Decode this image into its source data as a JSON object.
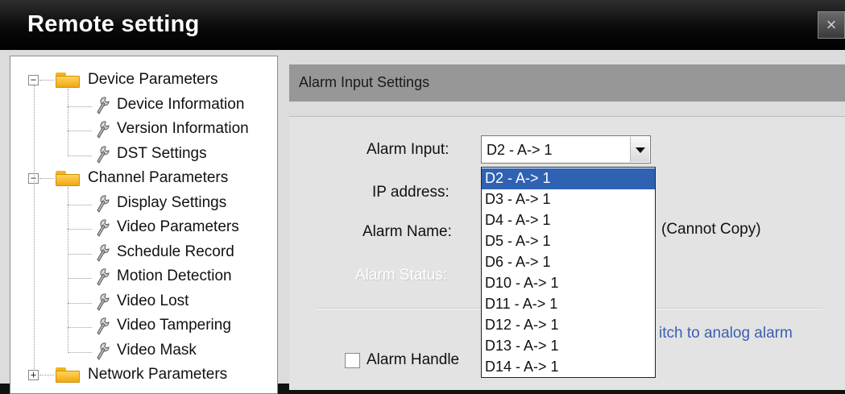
{
  "window": {
    "title": "Remote setting",
    "close_symbol": "×"
  },
  "tree": {
    "items": [
      {
        "label": "Device Parameters",
        "type": "folder",
        "expander": "−",
        "icon": "folder-icon"
      },
      {
        "label": "Device Information",
        "type": "leaf",
        "icon": "wrench-icon"
      },
      {
        "label": "Version Information",
        "type": "leaf",
        "icon": "wrench-icon"
      },
      {
        "label": "DST Settings",
        "type": "leaf",
        "icon": "wrench-icon"
      },
      {
        "label": "Channel Parameters",
        "type": "folder",
        "expander": "−",
        "icon": "folder-icon"
      },
      {
        "label": "Display Settings",
        "type": "leaf",
        "icon": "wrench-icon"
      },
      {
        "label": "Video Parameters",
        "type": "leaf",
        "icon": "wrench-icon"
      },
      {
        "label": "Schedule Record",
        "type": "leaf",
        "icon": "wrench-icon"
      },
      {
        "label": "Motion Detection",
        "type": "leaf",
        "icon": "wrench-icon"
      },
      {
        "label": "Video Lost",
        "type": "leaf",
        "icon": "wrench-icon"
      },
      {
        "label": "Video Tampering",
        "type": "leaf",
        "icon": "wrench-icon"
      },
      {
        "label": "Video Mask",
        "type": "leaf",
        "icon": "wrench-icon"
      },
      {
        "label": "Network Parameters",
        "type": "folder",
        "expander": "+",
        "icon": "folder-icon"
      }
    ]
  },
  "panel": {
    "header": "Alarm Input Settings",
    "alarm_input_label": "Alarm Input:",
    "alarm_input_value": "D2 - A-> 1",
    "ip_address_label": "IP address:",
    "alarm_name_label": "Alarm Name:",
    "alarm_status_label": "Alarm Status:",
    "cannot_copy_note": "(Cannot Copy)",
    "switch_link_partial": "itch to analog alarm",
    "alarm_handle_label": "Alarm Handle",
    "alarm_handle_checked": false
  },
  "dropdown": {
    "options": [
      "D2 - A-> 1",
      "D3 - A-> 1",
      "D4 - A-> 1",
      "D5 - A-> 1",
      "D6 - A-> 1",
      "D10 - A-> 1",
      "D11 - A-> 1",
      "D12 - A-> 1",
      "D13 - A-> 1",
      "D14 - A-> 1"
    ],
    "highlighted": "D2 - A-> 1"
  },
  "colors": {
    "titlebar": "#000000",
    "selection": "#2f62b3",
    "link": "#3b5fb0",
    "header_bar": "#979797"
  }
}
